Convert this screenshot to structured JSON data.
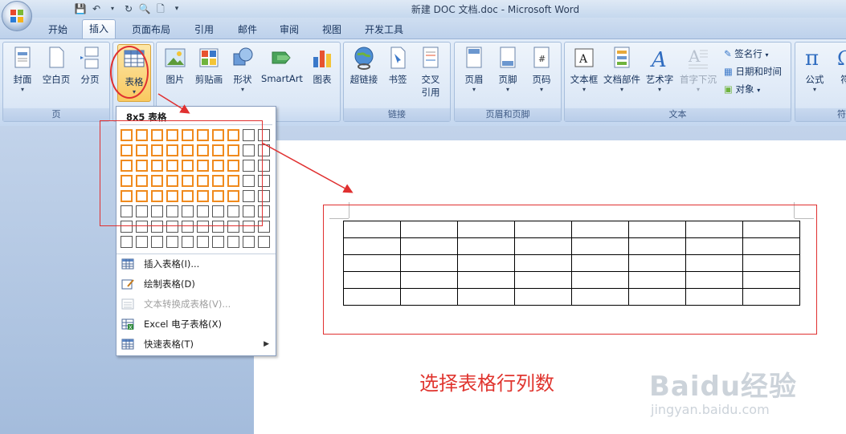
{
  "window": {
    "title": "新建 DOC 文档.doc - Microsoft Word"
  },
  "tabs": [
    "开始",
    "插入",
    "页面布局",
    "引用",
    "邮件",
    "审阅",
    "视图",
    "开发工具"
  ],
  "active_tab": "插入",
  "ribbon": {
    "groups": {
      "page": {
        "label": "页",
        "buttons": [
          "封面",
          "空白页",
          "分页"
        ]
      },
      "table": {
        "label": "表格"
      },
      "illustrations": {
        "buttons": [
          "图片",
          "剪贴画",
          "形状",
          "SmartArt",
          "图表"
        ]
      },
      "links": {
        "label": "链接",
        "buttons": [
          "超链接",
          "书签",
          "交叉\n引用"
        ]
      },
      "header_footer": {
        "label": "页眉和页脚",
        "buttons": [
          "页眉",
          "页脚",
          "页码"
        ]
      },
      "text": {
        "label": "文本",
        "buttons": [
          "文本框",
          "文档部件",
          "艺术字",
          "首字下沉"
        ],
        "small": [
          "签名行",
          "日期和时间",
          "对象"
        ]
      },
      "symbols": {
        "label": "符",
        "buttons": [
          "公式",
          "符"
        ]
      }
    }
  },
  "dropdown": {
    "title": "8x5 表格",
    "selected_cols": 8,
    "selected_rows": 5,
    "grid_cols": 10,
    "grid_rows": 8,
    "menu": [
      {
        "label": "插入表格(I)...",
        "icon": "insert-table-icon",
        "disabled": false
      },
      {
        "label": "绘制表格(D)",
        "icon": "draw-table-icon",
        "disabled": false
      },
      {
        "label": "文本转换成表格(V)...",
        "icon": "text-to-table-icon",
        "disabled": true
      },
      {
        "label": "Excel 电子表格(X)",
        "icon": "excel-icon",
        "disabled": false
      },
      {
        "label": "快速表格(T)",
        "icon": "quick-table-icon",
        "disabled": false,
        "submenu": true
      }
    ]
  },
  "document": {
    "table_rows": 5,
    "table_cols": 8
  },
  "annotation": {
    "caption": "选择表格行列数",
    "color": "#e0352f"
  },
  "watermark": {
    "brand": "Baidu经验",
    "url": "jingyan.baidu.com"
  }
}
